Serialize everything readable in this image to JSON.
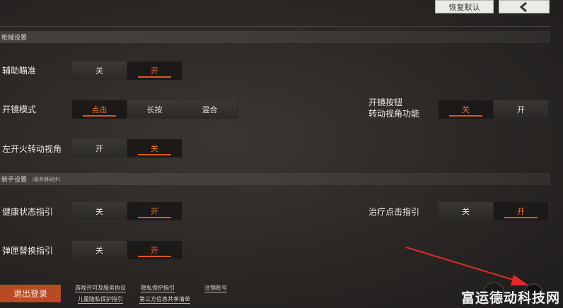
{
  "header": {
    "reset_label": "恢复默认"
  },
  "colors": {
    "accent": "#e0541e",
    "logout_bg": "#b84a25",
    "annotation_arrow": "#e02a2a"
  },
  "sections": {
    "gun": {
      "title": "枪械设置"
    },
    "novice": {
      "title": "新手设置",
      "subtitle": "（服务器同步）"
    }
  },
  "settings": {
    "aim_assist": {
      "label": "辅助瞄准",
      "options": [
        "关",
        "开"
      ],
      "selected": "开"
    },
    "scope_mode": {
      "label": "开镜模式",
      "options": [
        "点击",
        "长按",
        "混合"
      ],
      "selected": "点击"
    },
    "scope_button_rotate": {
      "label_line1": "开镜按钮",
      "label_line2": "转动视角功能",
      "options": [
        "关",
        "开"
      ],
      "selected": "关"
    },
    "left_fire_rotate": {
      "label": "左开火转动视角",
      "options": [
        "开",
        "关"
      ],
      "selected": "关"
    },
    "health_guide": {
      "label": "健康状态指引",
      "options": [
        "关",
        "开"
      ],
      "selected": "开"
    },
    "heal_tap_guide": {
      "label": "治疗点击指引",
      "options": [
        "关",
        "开"
      ],
      "selected": "开"
    },
    "mag_swap_guide": {
      "label": "弹匣替换指引",
      "options": [
        "关",
        "开"
      ],
      "selected": "开"
    }
  },
  "footer": {
    "logout_label": "退出登录",
    "links": {
      "license": "游戏许可及服务协议",
      "child_privacy": "儿童隐私保护指引",
      "privacy": "隐私保护指引",
      "third_party": "第三方信息共享清单",
      "cancel_account": "注销账号"
    }
  },
  "watermark": "富运德动科技网"
}
